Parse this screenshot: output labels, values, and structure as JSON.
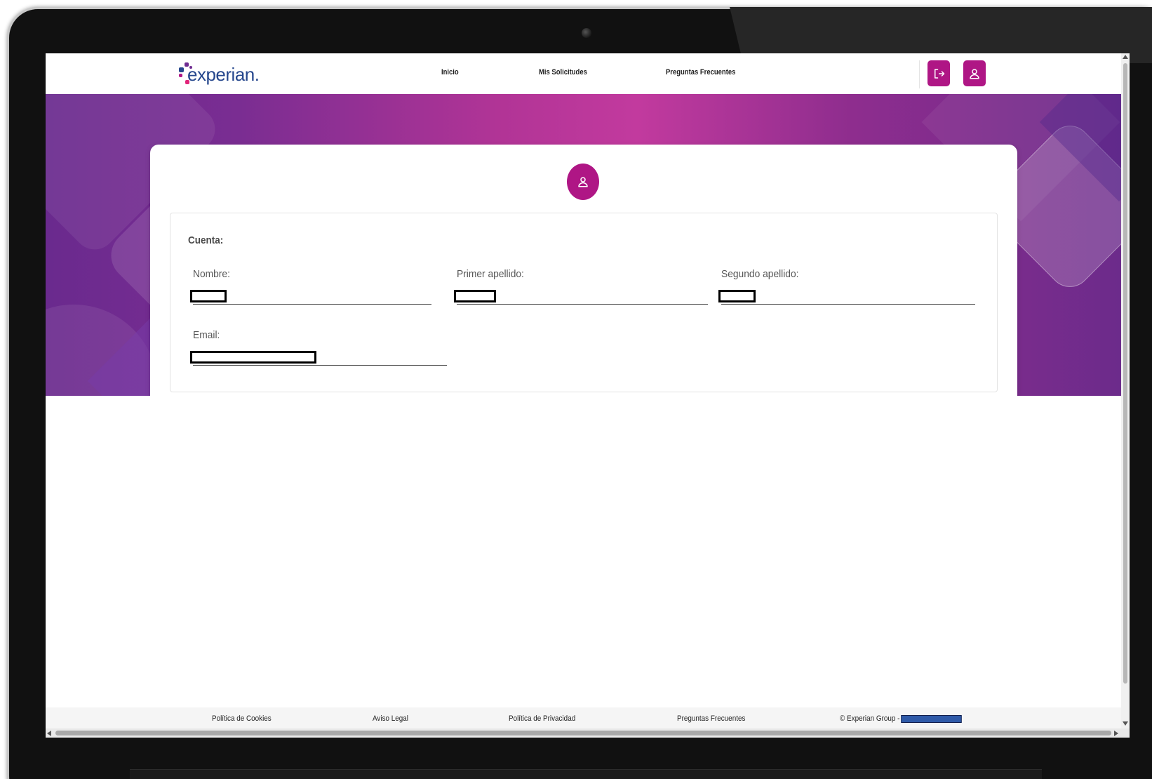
{
  "header": {
    "logo_text": "experian.",
    "nav": [
      "Inicio",
      "Mis Solicitudes",
      "Preguntas Frecuentes"
    ],
    "logout_icon": "logout-icon",
    "profile_icon": "user-icon"
  },
  "profile": {
    "avatar_icon": "user-icon",
    "section_title": "Cuenta:",
    "fields": {
      "nombre": {
        "label": "Nombre:"
      },
      "primer_apellido": {
        "label": "Primer apellido:"
      },
      "segundo_apellido": {
        "label": "Segundo apellido:"
      },
      "email": {
        "label": "Email:"
      }
    }
  },
  "footer": {
    "links": [
      "Política de Cookies",
      "Aviso Legal",
      "Política de Privacidad",
      "Preguntas Frecuentes"
    ],
    "copyright": "© Experian Group -"
  },
  "colors": {
    "brand_magenta": "#af1685",
    "brand_blue": "#26478d",
    "hero_purple": "#7a2d92",
    "hero_pink": "#c23a9e"
  }
}
